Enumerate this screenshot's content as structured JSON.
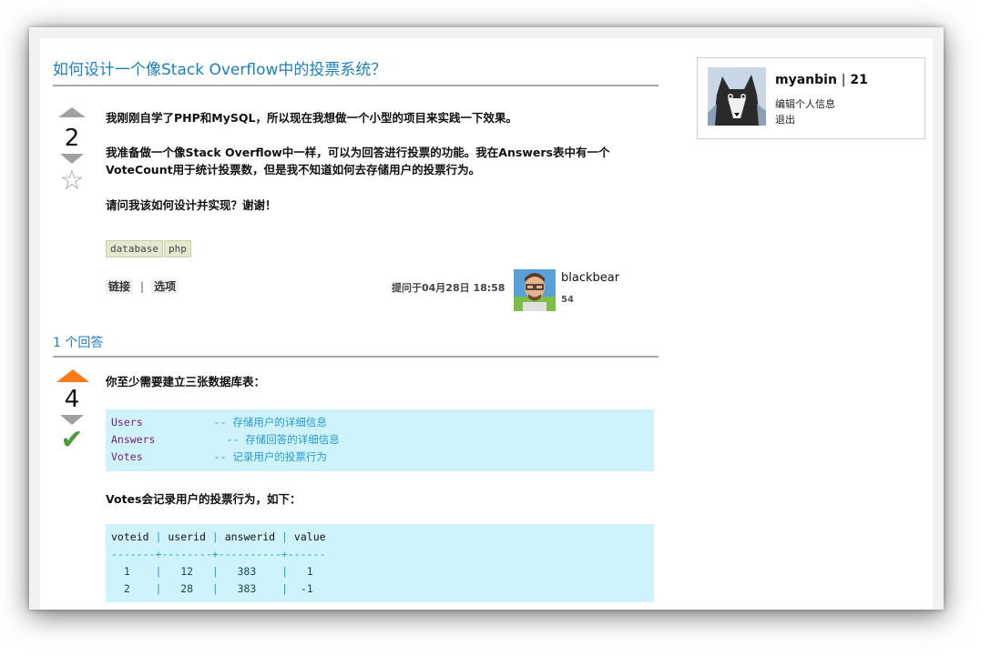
{
  "question": {
    "title": "如何设计一个像Stack Overflow中的投票系统？",
    "votes": "2",
    "paragraphs": [
      "我刚刚自学了PHP和MySQL，所以现在我想做一个小型的项目来实践一下效果。",
      "我准备做一个像Stack Overflow中一样，可以为回答进行投票的功能。我在Answers表中有一个VoteCount用于统计投票数，但是我不知道如何去存储用户的投票行为。",
      "请问我该如何设计并实现？谢谢！"
    ],
    "tags": [
      "database",
      "php"
    ],
    "menu": {
      "link": "链接",
      "separator": "|",
      "options": "选项"
    },
    "asked": "提问于04月28日 18:58",
    "owner": {
      "name": "blackbear",
      "rep": "54"
    }
  },
  "answers": {
    "header": "1 个回答",
    "items": [
      {
        "votes": "4",
        "intro": "你至少需要建立三张数据库表：",
        "tables": [
          {
            "name": "Users",
            "comment": "-- 存储用户的详细信息"
          },
          {
            "name": "Answers",
            "comment": "-- 存储回答的详细信息"
          },
          {
            "name": "Votes",
            "comment": "-- 记录用户的投票行为"
          }
        ],
        "votes_text": "Votes会记录用户的投票行为，如下：",
        "votes_table": {
          "columns": [
            "voteid",
            "userid",
            "answerid",
            "value"
          ],
          "divider": "-------+--------+----------+------",
          "rows": [
            [
              "1",
              "12",
              "383",
              "1"
            ],
            [
              "2",
              "28",
              "383",
              "-1"
            ]
          ]
        }
      }
    ]
  },
  "sidebar": {
    "username": "myanbin",
    "separator": "|",
    "reputation": "21",
    "edit_profile": "编辑个人信息",
    "logout": "退出"
  },
  "colors": {
    "title_blue": "#1a7fc1",
    "vote_up_active": "#ff7a18",
    "accepted_green": "#4a9a3c",
    "code_bg": "#cff3fb"
  }
}
